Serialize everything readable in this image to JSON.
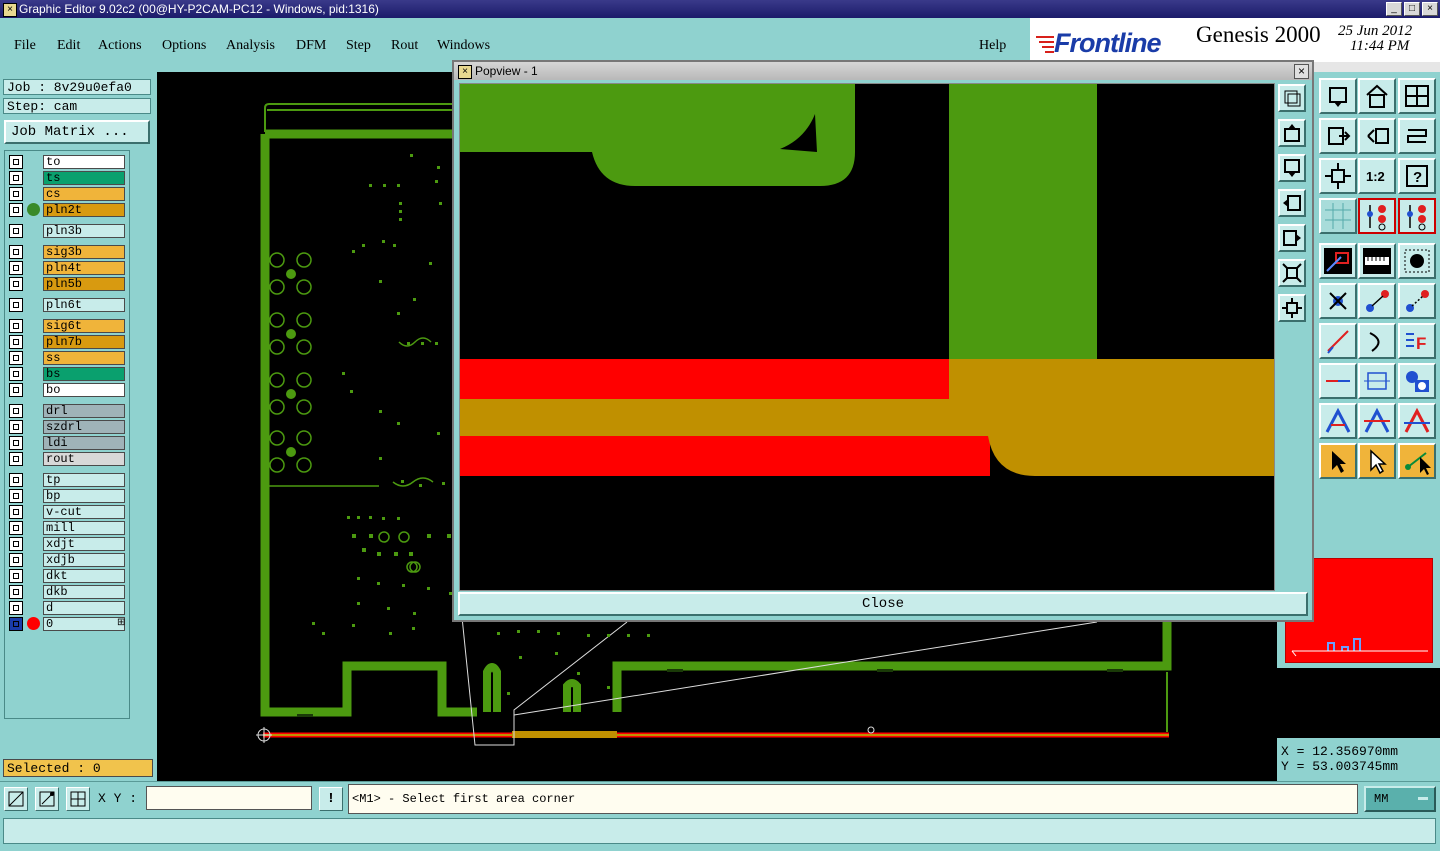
{
  "window": {
    "title": "Graphic Editor 9.02c2 (00@HY-P2CAM-PC12 - Windows, pid:1316)",
    "buttons": [
      "_",
      "□",
      "×"
    ]
  },
  "menu": {
    "items": [
      "File",
      "Edit",
      "Actions",
      "Options",
      "Analysis",
      "DFM",
      "Step",
      "Rout",
      "Windows"
    ],
    "help": "Help"
  },
  "brand": {
    "logo": "Frontline",
    "product": "Genesis 2000",
    "date": "25 Jun 2012",
    "time": "11:44 PM"
  },
  "job": {
    "job_line": "Job : 8v29u0efa0",
    "step_line": "Step: cam",
    "matrix_button": "Job Matrix ..."
  },
  "layers": [
    {
      "name": "to",
      "color": "#ffffff"
    },
    {
      "name": "ts",
      "color": "#0aa06e"
    },
    {
      "name": "cs",
      "color": "#f0b43a"
    },
    {
      "name": "pln2t",
      "color": "#d89a10",
      "dot": "#3a8a2a"
    },
    {
      "name": "pln3b",
      "color": "#c8ecea"
    },
    {
      "name": "sig3b",
      "color": "#f0b43a"
    },
    {
      "name": "pln4t",
      "color": "#f0b43a"
    },
    {
      "name": "pln5b",
      "color": "#d89a10"
    },
    {
      "name": "pln6t",
      "color": "#c8ecea"
    },
    {
      "name": "sig6t",
      "color": "#f0b43a"
    },
    {
      "name": "pln7b",
      "color": "#d89a10"
    },
    {
      "name": "ss",
      "color": "#f0b43a"
    },
    {
      "name": "bs",
      "color": "#0aa06e"
    },
    {
      "name": "bo",
      "color": "#ffffff"
    },
    {
      "name": "drl",
      "color": "#9fb3b8"
    },
    {
      "name": "szdrl",
      "color": "#9fb3b8"
    },
    {
      "name": "ldi",
      "color": "#9fb3b8"
    },
    {
      "name": "rout",
      "color": "#d8d8d8"
    },
    {
      "name": "tp",
      "color": "#c8ecea"
    },
    {
      "name": "bp",
      "color": "#c8ecea"
    },
    {
      "name": "v-cut",
      "color": "#c8ecea"
    },
    {
      "name": "mill",
      "color": "#c8ecea"
    },
    {
      "name": "xdjt",
      "color": "#c8ecea"
    },
    {
      "name": "xdjb",
      "color": "#c8ecea"
    },
    {
      "name": "dkt",
      "color": "#c8ecea"
    },
    {
      "name": "dkb",
      "color": "#c8ecea"
    },
    {
      "name": "d",
      "color": "#c8ecea"
    },
    {
      "name": "0",
      "color": "#c8ecea",
      "dot": "#ff0000",
      "marker": "⊞"
    }
  ],
  "selected": "Selected : 0",
  "popview": {
    "title": "Popview - 1",
    "close_label": "Close"
  },
  "coords": {
    "x": "X = 12.356970mm",
    "y": "Y = 53.003745mm"
  },
  "command": {
    "xy_label": "X Y :",
    "xy_value": "",
    "excl": "!",
    "prompt": "<M1> - Select first area corner",
    "units": "MM"
  },
  "colors": {
    "teal": "#8fd2cf",
    "pcb_green": "#4c9a10",
    "trace_red": "#ff0000",
    "trace_gold": "#c09000"
  }
}
